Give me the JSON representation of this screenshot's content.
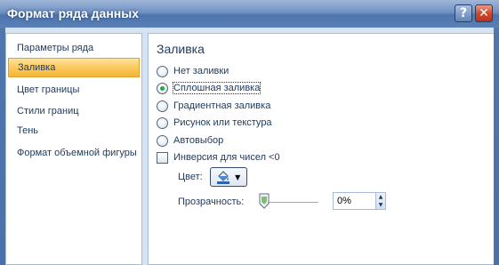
{
  "window": {
    "title": "Формат ряда данных",
    "help_label": "?",
    "close_label": "✕"
  },
  "categories": [
    {
      "label": "Параметры ряда",
      "selected": false
    },
    {
      "label": "Заливка",
      "selected": true
    },
    {
      "label": "Цвет границы",
      "selected": false
    },
    {
      "label": "Стили границ",
      "selected": false
    },
    {
      "label": "Тень",
      "selected": false
    },
    {
      "label": "Формат объемной фигуры",
      "selected": false
    }
  ],
  "fill": {
    "section_title": "Заливка",
    "options": [
      {
        "label": "Нет заливки",
        "checked": false
      },
      {
        "label": "Сплошная заливка",
        "checked": true
      },
      {
        "label": "Градиентная заливка",
        "checked": false
      },
      {
        "label": "Рисунок или текстура",
        "checked": false
      },
      {
        "label": "Автовыбор",
        "checked": false
      }
    ],
    "invert_label": "Инверсия для чисел <0",
    "invert_checked": false,
    "color_label": "Цвет:",
    "color_icon": "paint-bucket-icon",
    "transparency_label": "Прозрачность:",
    "transparency_value": "0%",
    "transparency_fraction": 0
  },
  "colors": {
    "accent_selected": "#fbc95e",
    "radio_checked": "#27a547",
    "title_bar": "#4e75ad"
  }
}
